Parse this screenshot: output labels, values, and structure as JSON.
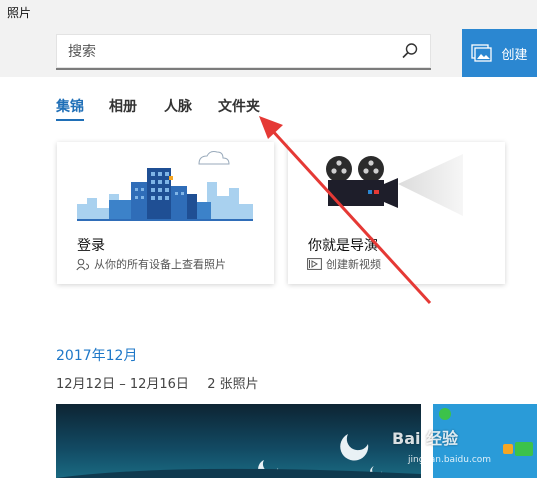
{
  "app": {
    "title": "照片"
  },
  "search": {
    "placeholder": "搜索"
  },
  "toolbar": {
    "create_label": "创建"
  },
  "tabs": [
    {
      "label": "集锦",
      "active": true
    },
    {
      "label": "相册",
      "active": false
    },
    {
      "label": "人脉",
      "active": false
    },
    {
      "label": "文件夹",
      "active": false
    }
  ],
  "cards": [
    {
      "title": "登录",
      "subtitle": "从你的所有设备上查看照片",
      "icon": "person-sync-icon"
    },
    {
      "title": "你就是导演",
      "subtitle": "创建新视频",
      "icon": "video-icon"
    }
  ],
  "collection": {
    "month": "2017年12月",
    "range": "12月12日 – 12月16日",
    "count": "2 张照片"
  },
  "watermark": {
    "brand": "Bai 经验",
    "url": "jingyan.baidu.com"
  },
  "colors": {
    "accent": "#2b87d1",
    "annotation": "#e53935"
  }
}
